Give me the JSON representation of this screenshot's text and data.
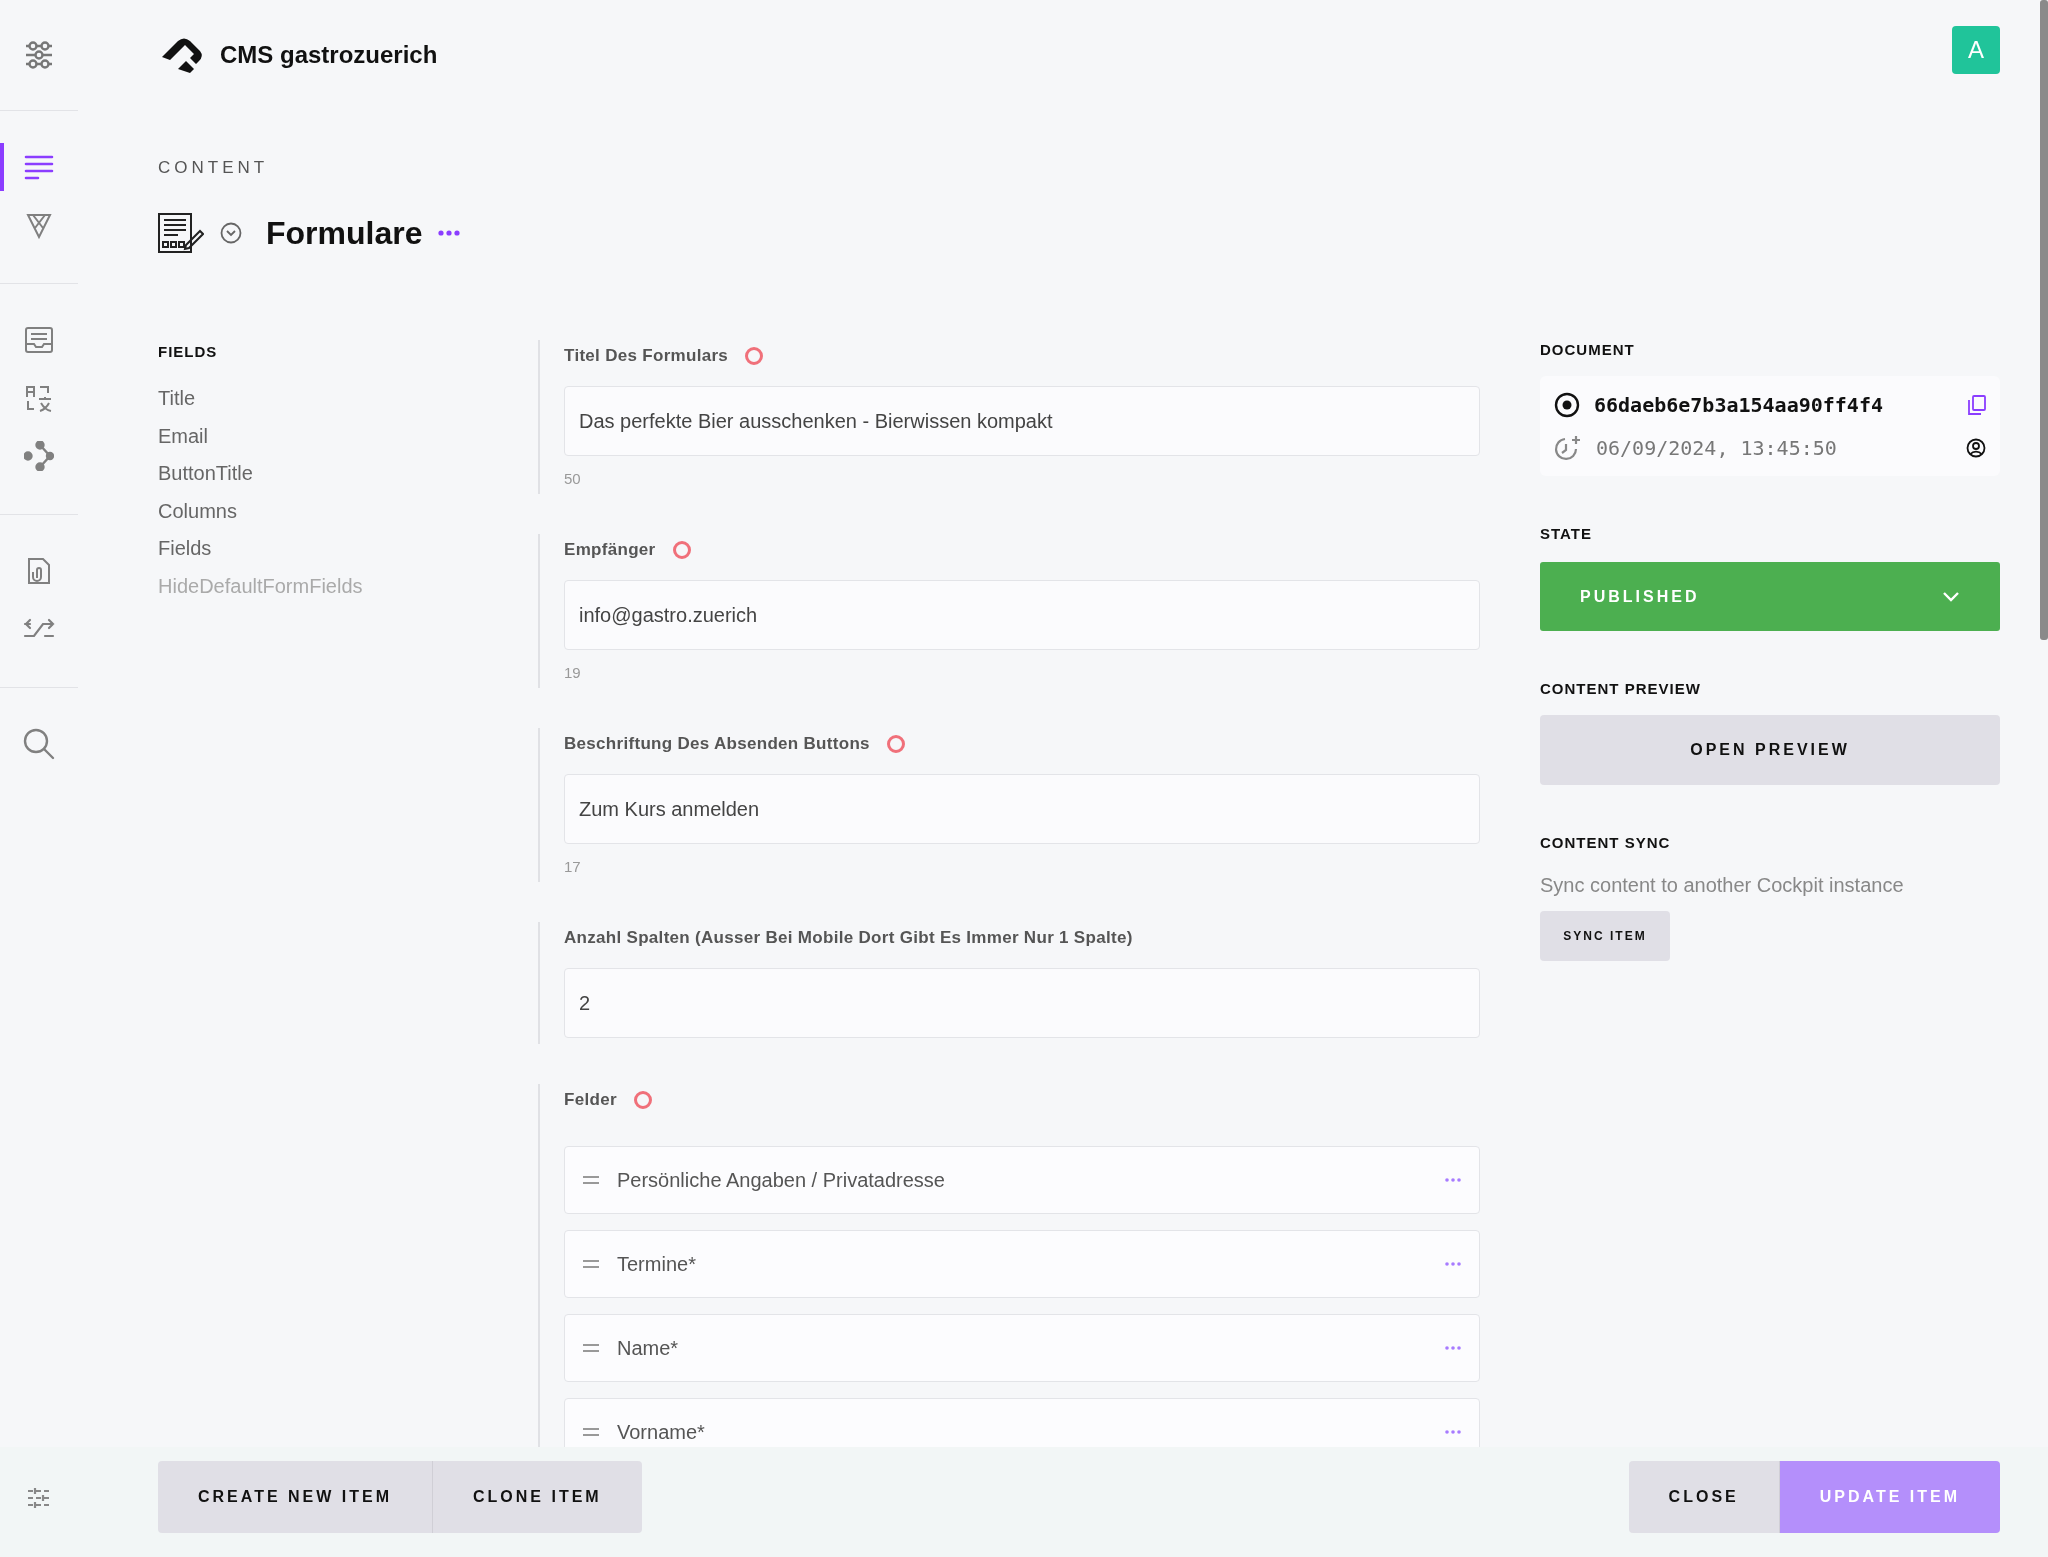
{
  "app": {
    "title": "CMS gastrozuerich",
    "avatar": "A"
  },
  "sidebar": {
    "items": [
      {
        "selected": true
      },
      {
        "selected": false
      },
      {
        "selected": false
      },
      {
        "selected": false
      },
      {
        "selected": false
      },
      {
        "selected": false
      },
      {
        "selected": false
      },
      {
        "selected": false
      }
    ]
  },
  "breadcrumb": "CONTENT",
  "page": {
    "title": "Formulare"
  },
  "fields_nav": {
    "heading": "FIELDS",
    "items": [
      {
        "label": "Title",
        "disabled": false
      },
      {
        "label": "Email",
        "disabled": false
      },
      {
        "label": "ButtonTitle",
        "disabled": false
      },
      {
        "label": "Columns",
        "disabled": false
      },
      {
        "label": "Fields",
        "disabled": false
      },
      {
        "label": "HideDefaultFormFields",
        "disabled": true
      }
    ]
  },
  "form": {
    "fields": [
      {
        "kind": "text",
        "label": "Titel Des Formulars",
        "required": true,
        "value": "Das perfekte Bier ausschenken - Bierwissen kompakt",
        "count": "50"
      },
      {
        "kind": "text",
        "label": "Empfänger",
        "required": true,
        "value": "info@gastro.zuerich",
        "count": "19"
      },
      {
        "kind": "text",
        "label": "Beschriftung Des Absenden Buttons",
        "required": true,
        "value": "Zum Kurs anmelden",
        "count": "17"
      },
      {
        "kind": "text",
        "label": "Anzahl Spalten (Ausser Bei Mobile Dort Gibt Es Immer Nur 1 Spalte)",
        "required": false,
        "value": "2"
      },
      {
        "kind": "list",
        "label": "Felder",
        "required": true,
        "items": [
          {
            "label": "Persönliche Angaben / Privatadresse"
          },
          {
            "label": "Termine*"
          },
          {
            "label": "Name*"
          },
          {
            "label": "Vorname*"
          }
        ]
      }
    ]
  },
  "document": {
    "heading": "DOCUMENT",
    "id": "66daeb6e7b3a154aa90ff4f4",
    "modified": "06/09/2024, 13:45:50"
  },
  "state": {
    "heading": "STATE",
    "value": "PUBLISHED",
    "published": true
  },
  "preview": {
    "heading": "CONTENT PREVIEW",
    "button": "OPEN PREVIEW"
  },
  "sync": {
    "heading": "CONTENT SYNC",
    "description": "Sync content to another Cockpit instance",
    "button": "SYNC ITEM"
  },
  "footer": {
    "left_buttons": [
      "CREATE NEW ITEM",
      "CLONE ITEM"
    ],
    "right_buttons": [
      {
        "label": "CLOSE",
        "primary": false
      },
      {
        "label": "UPDATE ITEM",
        "primary": true
      }
    ]
  }
}
